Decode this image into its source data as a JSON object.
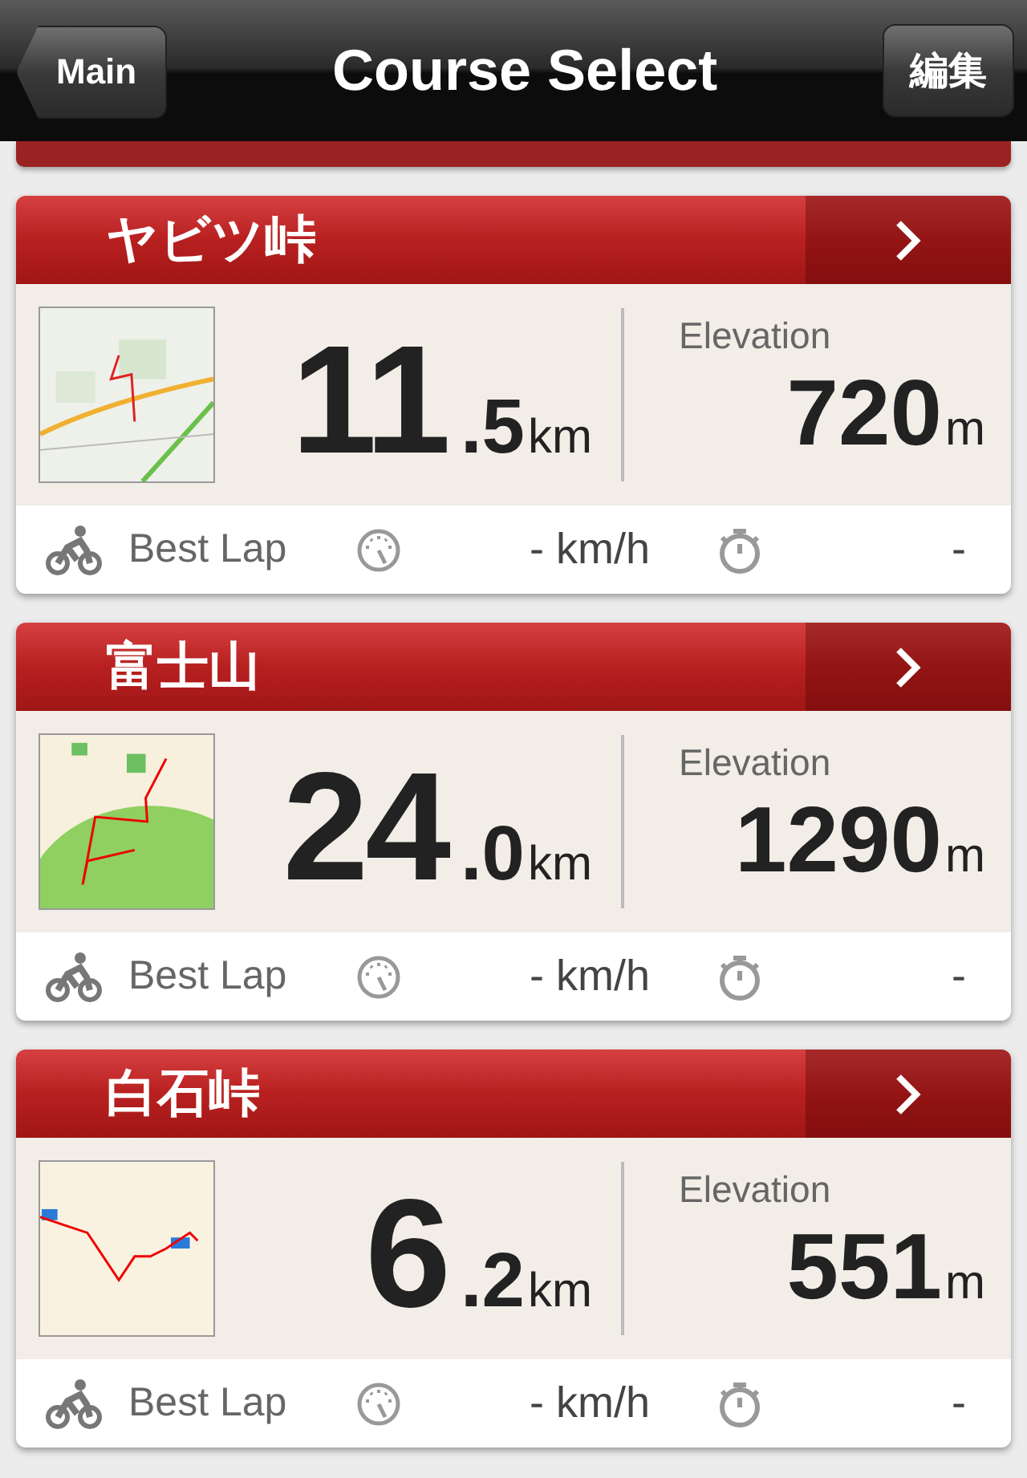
{
  "nav": {
    "back": "Main",
    "title": "Course Select",
    "edit": "編集"
  },
  "courses": [
    {
      "name": "ヤビツ峠",
      "distance_whole": "11",
      "distance_fraction": ".5",
      "distance_unit": "km",
      "elevation_label": "Elevation",
      "elevation": "720",
      "elevation_unit": "m",
      "best_lap_label": "Best Lap",
      "speed": "- km/h",
      "time": "-"
    },
    {
      "name": "富士山",
      "distance_whole": "24",
      "distance_fraction": ".0",
      "distance_unit": "km",
      "elevation_label": "Elevation",
      "elevation": "1290",
      "elevation_unit": "m",
      "best_lap_label": "Best Lap",
      "speed": "- km/h",
      "time": "-"
    },
    {
      "name": "白石峠",
      "distance_whole": "6",
      "distance_fraction": ".2",
      "distance_unit": "km",
      "elevation_label": "Elevation",
      "elevation": "551",
      "elevation_unit": "m",
      "best_lap_label": "Best Lap",
      "speed": "- km/h",
      "time": "-"
    }
  ]
}
